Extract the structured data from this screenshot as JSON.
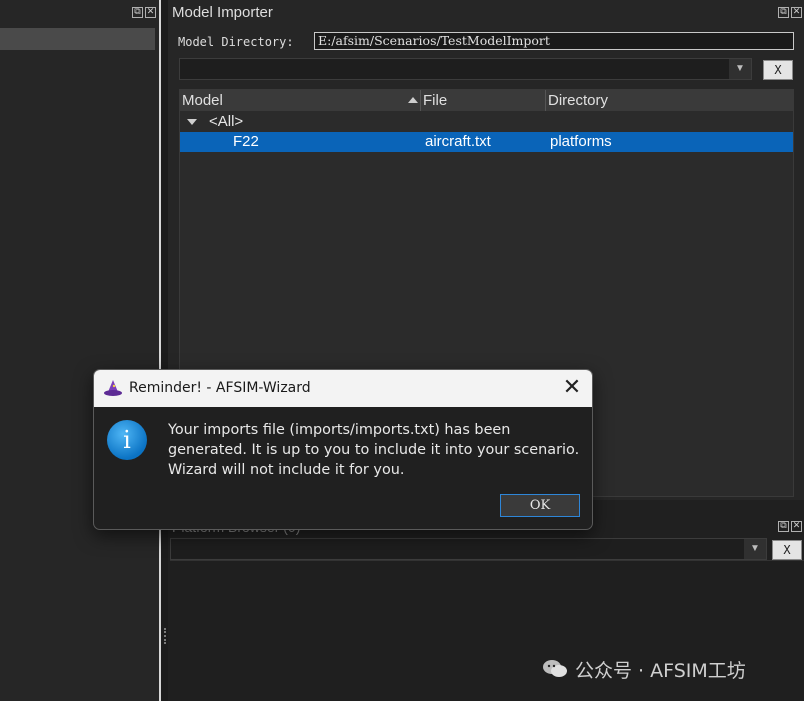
{
  "importer": {
    "title": "Model Importer",
    "directory_label": "Model Directory:",
    "directory_value": "E:/afsim/Scenarios/TestModelImport",
    "clear_label": "X",
    "columns": [
      "Model",
      "File",
      "Directory"
    ],
    "rows": [
      {
        "model": "<All>",
        "file": "",
        "directory": "",
        "expanded": true
      },
      {
        "model": "F22",
        "file": "aircraft.txt",
        "directory": "platforms",
        "selected": true
      }
    ]
  },
  "platform_browser": {
    "title": "Platform Browser (0)",
    "clear_label": "X"
  },
  "dialog": {
    "title": "Reminder! - AFSIM-Wizard",
    "close_glyph": "✕",
    "info_glyph": "i",
    "message": "Your imports file (imports/imports.txt) has been generated. It is up to you to include it into your scenario. Wizard will not include it for you.",
    "ok_label": "OK"
  },
  "watermark": {
    "text": "公众号 · AFSIM工坊"
  },
  "colors": {
    "selection": "#0a64b8",
    "info_blue": "#0b73c4",
    "focus_border": "#2e86d8"
  }
}
